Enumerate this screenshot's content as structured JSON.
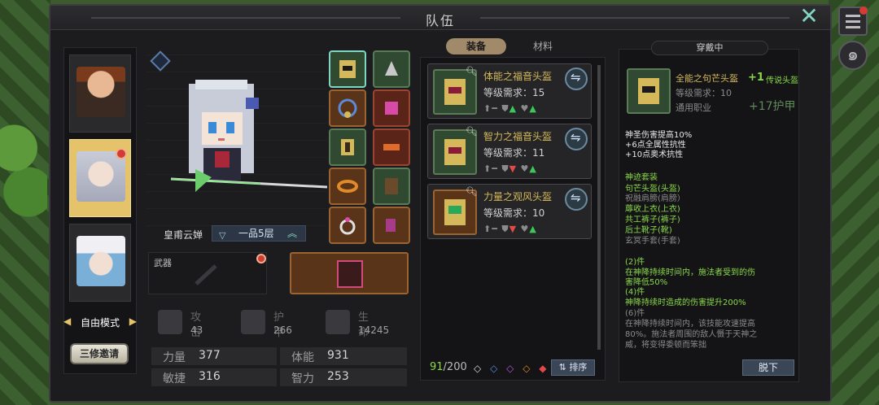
{
  "window": {
    "title": "队伍",
    "close_label": "✕"
  },
  "roster": {
    "mode_label": "自由模式",
    "invite_label": "三修邀请"
  },
  "character": {
    "name": "皇甫云婵",
    "tier": "一品5层"
  },
  "weapon": {
    "label": "武器"
  },
  "stats": {
    "attack": {
      "label": "攻击",
      "value": "43"
    },
    "armor": {
      "label": "护甲",
      "value": "266"
    },
    "hp": {
      "label": "生命",
      "value": "14245"
    },
    "attrs": [
      {
        "name": "力量",
        "value": "377"
      },
      {
        "name": "体能",
        "value": "931"
      },
      {
        "name": "敏捷",
        "value": "316"
      },
      {
        "name": "智力",
        "value": "253"
      }
    ]
  },
  "tabs": {
    "equip": "装备",
    "material": "材料"
  },
  "items": [
    {
      "name": "体能之福音头盔",
      "req": "等级需求：15",
      "bg": "green"
    },
    {
      "name": "智力之福音头盔",
      "req": "等级需求：11",
      "bg": "green"
    },
    {
      "name": "力量之观风头盔",
      "req": "等级需求：10",
      "bg": "brown"
    }
  ],
  "inventory": {
    "current": "91",
    "total": "/200",
    "sort_label": "排序"
  },
  "worn": {
    "title": "穿戴中",
    "name": "全能之句芒头盔",
    "req": "等级需求：10",
    "class": "通用职业",
    "level": "+1",
    "rarity": "传说头盔",
    "armor": "+17护甲",
    "stats": [
      "神圣伤害提高10%",
      "+6点全属性抗性",
      "+10点奥术抗性"
    ],
    "set_title": "神迹套装",
    "set_items": [
      {
        "text": "句芒头盔(头盔)",
        "owned": true
      },
      {
        "text": "祝融肩膀(肩膀）",
        "owned": false
      },
      {
        "text": "蓐收上衣(上衣)",
        "owned": true
      },
      {
        "text": "共工裤子(裤子)",
        "owned": true
      },
      {
        "text": "后土靴子(靴)",
        "owned": true
      },
      {
        "text": "玄冥手套(手套)",
        "owned": false
      }
    ],
    "bonus2_title": "(2)件",
    "bonus2_text": [
      "在神降持续时间内，施法者受到的伤",
      "害降低50%"
    ],
    "bonus4_title": "(4)件",
    "bonus4_text": [
      "神降持续时造成的伤害提升200%"
    ],
    "bonus6_title": "(6)件",
    "bonus6_text": [
      "在神降持续时间内，该技能攻速提高",
      "80%。施法者周围的敌人慑于天神之",
      "威，将变得委顿而笨拙"
    ],
    "takeoff_label": "脱下"
  },
  "colors": {
    "accent": "#7fd6c2",
    "gold": "#d4b85a",
    "green": "#8ad84a",
    "panel": "#141416"
  }
}
